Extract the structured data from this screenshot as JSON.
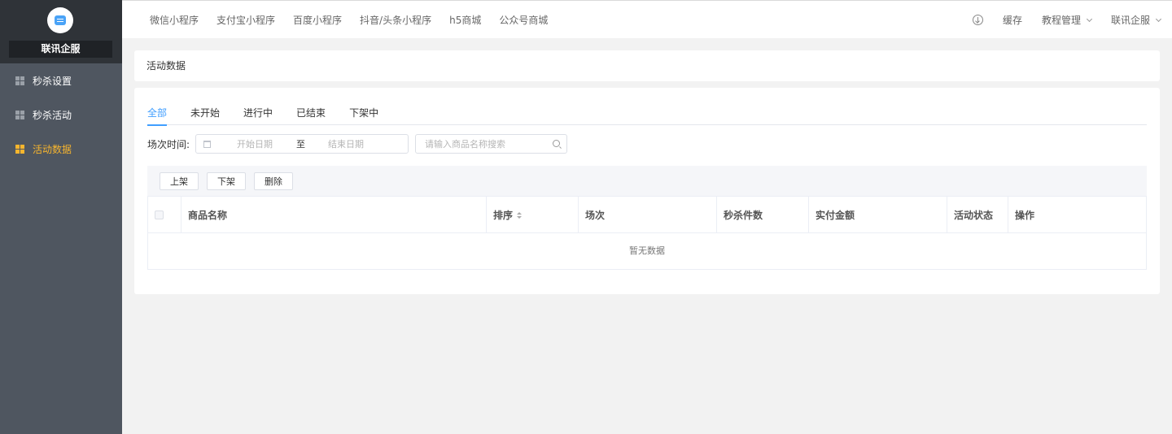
{
  "sidebar": {
    "brand_name": "联讯企服",
    "items": [
      {
        "label": "秒杀设置",
        "active": false
      },
      {
        "label": "秒杀活动",
        "active": false
      },
      {
        "label": "活动数据",
        "active": true
      }
    ]
  },
  "topbar": {
    "nav": [
      "微信小程序",
      "支付宝小程序",
      "百度小程序",
      "抖音/头条小程序",
      "h5商城",
      "公众号商城"
    ],
    "cache_label": "缓存",
    "tutorial_label": "教程管理",
    "user_label": "联讯企服"
  },
  "breadcrumb": "活动数据",
  "tabs": [
    "全部",
    "未开始",
    "进行中",
    "已结束",
    "下架中"
  ],
  "filter": {
    "label": "场次时间:",
    "start_placeholder": "开始日期",
    "separator": "至",
    "end_placeholder": "结束日期",
    "search_placeholder": "请输入商品名称搜索"
  },
  "toolbar": {
    "up_label": "上架",
    "down_label": "下架",
    "delete_label": "删除"
  },
  "table": {
    "columns": [
      "商品名称",
      "排序",
      "场次",
      "秒杀件数",
      "实付金额",
      "活动状态",
      "操作"
    ],
    "empty_text": "暂无数据"
  },
  "colors": {
    "sidebar_bg": "#4f5660",
    "brand_bg": "#2f3338",
    "active_menu": "#f7b52e",
    "accent": "#409eff"
  }
}
